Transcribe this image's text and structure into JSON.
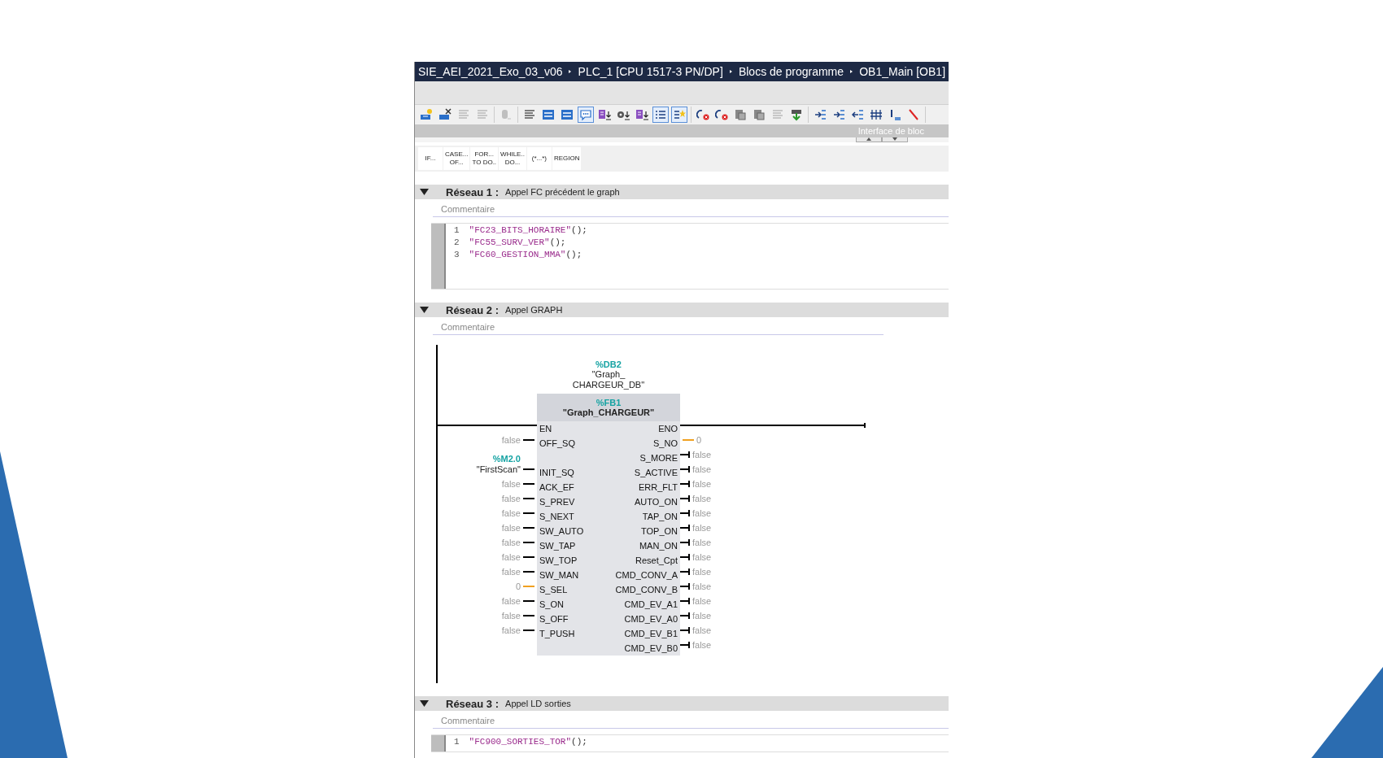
{
  "breadcrumb": [
    "SIE_AEI_2021_Exo_03_v06",
    "PLC_1 [CPU 1517-3 PN/DP]",
    "Blocs de programme",
    "OB1_Main [OB1]"
  ],
  "toolbar": [
    [
      {
        "pressed": false,
        "disabled": false
      },
      {
        "pressed": false,
        "disabled": false
      },
      {
        "pressed": false,
        "disabled": true
      },
      {
        "pressed": false,
        "disabled": true
      }
    ],
    [
      {
        "pressed": false,
        "disabled": true
      }
    ],
    [
      {
        "pressed": false,
        "disabled": false
      },
      {
        "pressed": false,
        "disabled": false
      },
      {
        "pressed": false,
        "disabled": false
      },
      {
        "pressed": true,
        "disabled": false
      },
      {
        "pressed": false,
        "disabled": false
      },
      {
        "pressed": false,
        "disabled": false
      },
      {
        "pressed": false,
        "disabled": false
      },
      {
        "pressed": true,
        "disabled": false
      },
      {
        "pressed": true,
        "disabled": false
      }
    ],
    [
      {
        "pressed": false,
        "disabled": false
      },
      {
        "pressed": false,
        "disabled": false
      },
      {
        "pressed": false,
        "disabled": false
      },
      {
        "pressed": false,
        "disabled": false
      },
      {
        "pressed": false,
        "disabled": true
      },
      {
        "pressed": false,
        "disabled": false
      }
    ],
    [
      {
        "pressed": false,
        "disabled": false
      },
      {
        "pressed": false,
        "disabled": false
      },
      {
        "pressed": false,
        "disabled": false
      },
      {
        "pressed": false,
        "disabled": false
      },
      {
        "pressed": false,
        "disabled": false
      },
      {
        "pressed": false,
        "disabled": false
      }
    ]
  ],
  "interface_bar": {
    "label": "Interface de bloc"
  },
  "instructions": [
    "IF...",
    "CASE...\nOF...",
    "FOR...\nTO DO..",
    "WHILE..\nDO...",
    "(*...*)",
    "REGION"
  ],
  "networks": [
    {
      "title": "Réseau 1 :",
      "description": "Appel FC précédent le graph",
      "comment": "Commentaire",
      "expanded": true,
      "kind": "scl",
      "lines": [
        {
          "number": "1",
          "call": "\"FC23_BITS_HORAIRE\"",
          "rest": "();"
        },
        {
          "number": "2",
          "call": "\"FC55_SURV_VER\"",
          "rest": "();"
        },
        {
          "number": "3",
          "call": "\"FC60_GESTION_MMA\"",
          "rest": "();"
        }
      ]
    },
    {
      "title": "Réseau 2 :",
      "description": "Appel GRAPH",
      "comment": "Commentaire",
      "expanded": true,
      "kind": "fbd",
      "block": {
        "instance_address": "%DB2",
        "instance_name": "\"Graph_\nCHARGEUR_DB\"",
        "address": "%FB1",
        "name": "\"Graph_CHARGEUR\"",
        "rows": [
          {
            "in": {
              "pin": "EN",
              "kind": "en"
            },
            "out": {
              "pin": "ENO",
              "kind": "eno"
            }
          },
          {
            "in": {
              "pin": "OFF_SQ",
              "kind": "bool",
              "value": "false"
            },
            "out": {
              "pin": "S_NO",
              "kind": "int",
              "value": "0"
            }
          },
          {
            "out": {
              "pin": "S_MORE",
              "kind": "bool",
              "value": "false"
            }
          },
          {
            "in": {
              "pin": "INIT_SQ",
              "kind": "bool",
              "value": "\"FirstScan\"",
              "address": "%M2.0"
            },
            "out": {
              "pin": "S_ACTIVE",
              "kind": "bool",
              "value": "false"
            }
          },
          {
            "in": {
              "pin": "ACK_EF",
              "kind": "bool",
              "value": "false"
            },
            "out": {
              "pin": "ERR_FLT",
              "kind": "bool",
              "value": "false"
            }
          },
          {
            "in": {
              "pin": "S_PREV",
              "kind": "bool",
              "value": "false"
            },
            "out": {
              "pin": "AUTO_ON",
              "kind": "bool",
              "value": "false"
            }
          },
          {
            "in": {
              "pin": "S_NEXT",
              "kind": "bool",
              "value": "false"
            },
            "out": {
              "pin": "TAP_ON",
              "kind": "bool",
              "value": "false"
            }
          },
          {
            "in": {
              "pin": "SW_AUTO",
              "kind": "bool",
              "value": "false"
            },
            "out": {
              "pin": "TOP_ON",
              "kind": "bool",
              "value": "false"
            }
          },
          {
            "in": {
              "pin": "SW_TAP",
              "kind": "bool",
              "value": "false"
            },
            "out": {
              "pin": "MAN_ON",
              "kind": "bool",
              "value": "false"
            }
          },
          {
            "in": {
              "pin": "SW_TOP",
              "kind": "bool",
              "value": "false"
            },
            "out": {
              "pin": "Reset_Cpt",
              "kind": "bool",
              "value": "false"
            }
          },
          {
            "in": {
              "pin": "SW_MAN",
              "kind": "bool",
              "value": "false"
            },
            "out": {
              "pin": "CMD_CONV_A",
              "kind": "bool",
              "value": "false"
            }
          },
          {
            "in": {
              "pin": "S_SEL",
              "kind": "int",
              "value": "0"
            },
            "out": {
              "pin": "CMD_CONV_B",
              "kind": "bool",
              "value": "false"
            }
          },
          {
            "in": {
              "pin": "S_ON",
              "kind": "bool",
              "value": "false"
            },
            "out": {
              "pin": "CMD_EV_A1",
              "kind": "bool",
              "value": "false"
            }
          },
          {
            "in": {
              "pin": "S_OFF",
              "kind": "bool",
              "value": "false"
            },
            "out": {
              "pin": "CMD_EV_A0",
              "kind": "bool",
              "value": "false"
            }
          },
          {
            "in": {
              "pin": "T_PUSH",
              "kind": "bool",
              "value": "false"
            },
            "out": {
              "pin": "CMD_EV_B1",
              "kind": "bool",
              "value": "false"
            }
          },
          {
            "out": {
              "pin": "CMD_EV_B0",
              "kind": "bool",
              "value": "false"
            }
          }
        ]
      }
    },
    {
      "title": "Réseau 3 :",
      "description": "Appel LD sorties",
      "comment": "Commentaire",
      "expanded": true,
      "kind": "scl",
      "lines": [
        {
          "number": "1",
          "call": "\"FC900_SORTIES_TOR\"",
          "rest": "();"
        }
      ]
    }
  ]
}
